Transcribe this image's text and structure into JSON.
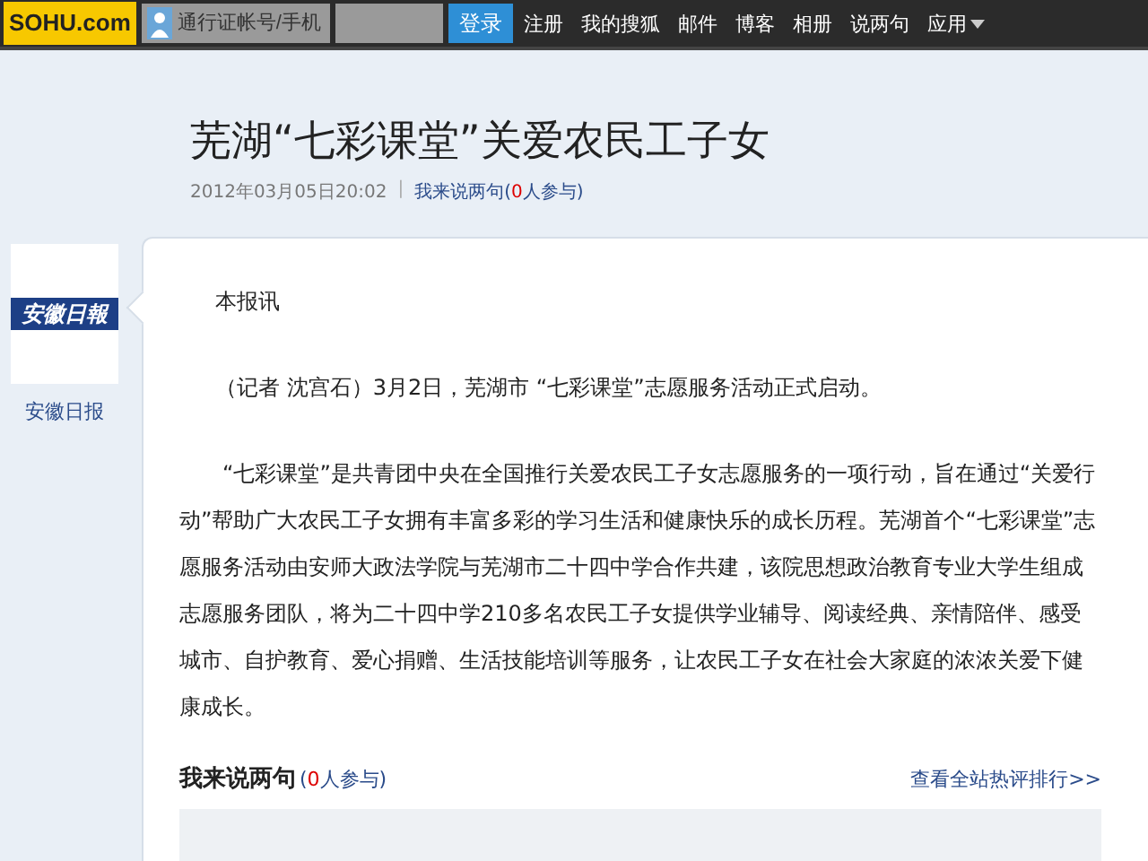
{
  "top_bar": {
    "logo": "SOHU.com",
    "account_field": {
      "placeholder": "通行证帐号/手机"
    },
    "login_button": "登录",
    "links": [
      {
        "label": "注册",
        "dropdown": false
      },
      {
        "label": "我的搜狐",
        "dropdown": false
      },
      {
        "label": "邮件",
        "dropdown": false
      },
      {
        "label": "博客",
        "dropdown": false
      },
      {
        "label": "相册",
        "dropdown": false
      },
      {
        "label": "说两句",
        "dropdown": false
      },
      {
        "label": "应用",
        "dropdown": true
      }
    ]
  },
  "article": {
    "title": "芜湖“七彩课堂”关爱农民工子女",
    "date": "2012年03月05日20:02",
    "separator": "|",
    "comment_link": "我来说两句",
    "comment_open": "(",
    "comment_count": "0",
    "comment_close": "人参与)"
  },
  "source": {
    "logo": "安徽日報",
    "name": "安徽日报"
  },
  "paragraphs": [
    {
      "kind": "plain",
      "text": "本报讯"
    },
    {
      "kind": "plain",
      "text": "（记者  沈宫石）3月2日，芜湖市 “七彩课堂”志愿服务活动正式启动。"
    },
    {
      "kind": "indented",
      "text": "“七彩课堂”是共青团中央在全国推行关爱农民工子女志愿服务的一项行动，旨在通过“关爱行动”帮助广大农民工子女拥有丰富多彩的学习生活和健康快乐的成长历程。芜湖首个“七彩课堂”志愿服务活动由安师大政法学院与芜湖市二十四中学合作共建，该院思想政治教育专业大学生组成志愿服务团队，将为二十四中学210多名农民工子女提供学业辅导、阅读经典、亲情陪伴、感受城市、自护教育、爱心捐赠、生活技能培训等服务，让农民工子女在社会大家庭的浓浓关爱下健康成长。"
    }
  ],
  "comments": {
    "heading": "我来说两句",
    "open": "(",
    "count": "0",
    "close": "人参与)",
    "ranking_link": "查看全站热评排行>>"
  }
}
